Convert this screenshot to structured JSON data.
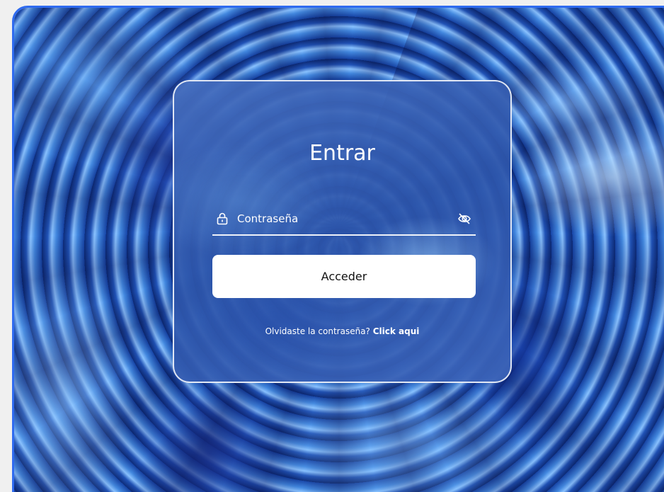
{
  "login": {
    "title": "Entrar",
    "password_placeholder": "Contraseña",
    "submit_label": "Acceder",
    "forgot_text": "Olvidaste la contraseña?",
    "forgot_link": "Click aqui"
  },
  "icons": {
    "lock": "lock-icon",
    "toggle_visibility": "eye-off-icon"
  },
  "colors": {
    "frame_border": "#2f6bf0",
    "button_bg": "#ffffff",
    "text": "#ffffff"
  }
}
